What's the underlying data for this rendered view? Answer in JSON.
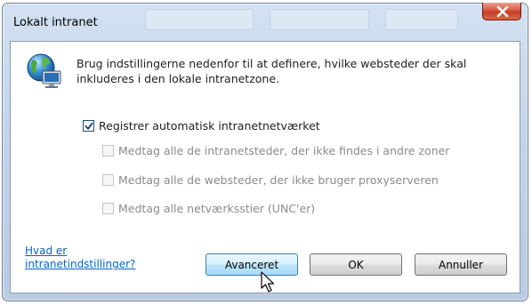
{
  "window": {
    "title": "Lokalt intranet",
    "close_icon": "close-icon"
  },
  "description": "Brug indstillingerne nedenfor til at definere, hvilke websteder der skal inkluderes i den lokale intranetzone.",
  "options": {
    "auto_detect": {
      "label": "Registrer automatisk intranetnetværket",
      "checked": true,
      "enabled": true
    },
    "sub_options": [
      {
        "label": "Medtag alle de intranetsteder, der ikke findes i andre zoner",
        "checked": false,
        "enabled": false
      },
      {
        "label": "Medtag alle de websteder, der ikke bruger proxyserveren",
        "checked": false,
        "enabled": false
      },
      {
        "label": "Medtag alle netværksstier (UNC'er)",
        "checked": false,
        "enabled": false
      }
    ]
  },
  "help_link": {
    "line1": "Hvad er",
    "line2": "intranetindstillinger?"
  },
  "buttons": {
    "advanced": "Avanceret",
    "ok": "OK",
    "cancel": "Annuller"
  },
  "icons": {
    "zone": "intranet-globe-icon",
    "cursor": "mouse-pointer-icon"
  },
  "colors": {
    "link": "#0066cc",
    "close_button": "#c33b22",
    "disabled_text": "#8b8b8b"
  }
}
